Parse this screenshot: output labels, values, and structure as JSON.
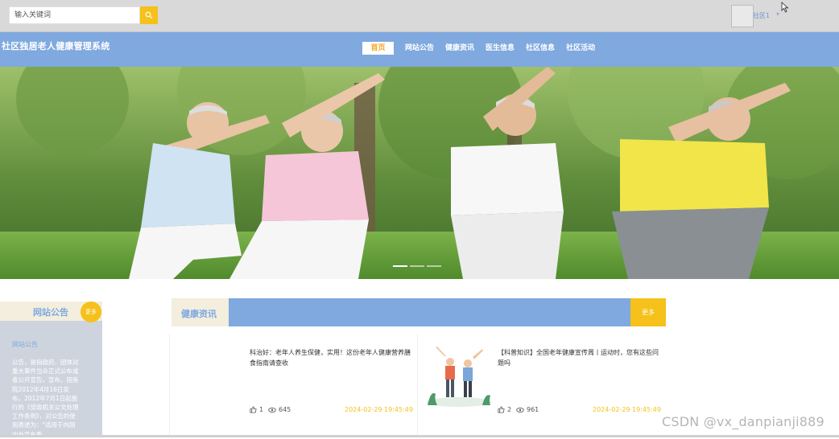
{
  "search": {
    "placeholder": "输入关键词",
    "button_icon": "search-icon"
  },
  "user": {
    "name": "社区1",
    "caret": "▾"
  },
  "site": {
    "title": "社区独居老人健康管理系统"
  },
  "nav": {
    "items": [
      {
        "label": "首页",
        "active": true
      },
      {
        "label": "网站公告"
      },
      {
        "label": "健康资讯"
      },
      {
        "label": "医生信息"
      },
      {
        "label": "社区信息"
      },
      {
        "label": "社区活动"
      }
    ]
  },
  "notice": {
    "title": "网站公告",
    "more": "更多",
    "sub_title": "网站公告",
    "body": "公告，是指政府、团体对重大事件当众正式公布或者公开宣告，宣布。国务院2012年4月16日发布，2012年7月1日起施行的《党政机关公文处理工作条例》，对公告的使用表述为：\"适用于向国内外宣布重"
  },
  "health": {
    "title": "健康资讯",
    "more": "更多",
    "articles": [
      {
        "title": "科治好：老年人养生保健，实用！这份老年人健康营养膳食指南请查收",
        "likes": "1",
        "views": "645",
        "date": "2024-02-29 19:45:49"
      },
      {
        "title": "【科普知识】全国老年健康宣传周丨运动时，您有这些问题吗",
        "likes": "2",
        "views": "961",
        "date": "2024-02-29 19:45:49"
      }
    ]
  },
  "watermark": "CSDN @vx_danpianji889",
  "colors": {
    "nav_blue": "#7fa9df",
    "accent_yellow": "#f5c11a",
    "cream": "#f3eede",
    "panel_gray": "#ced4de"
  }
}
